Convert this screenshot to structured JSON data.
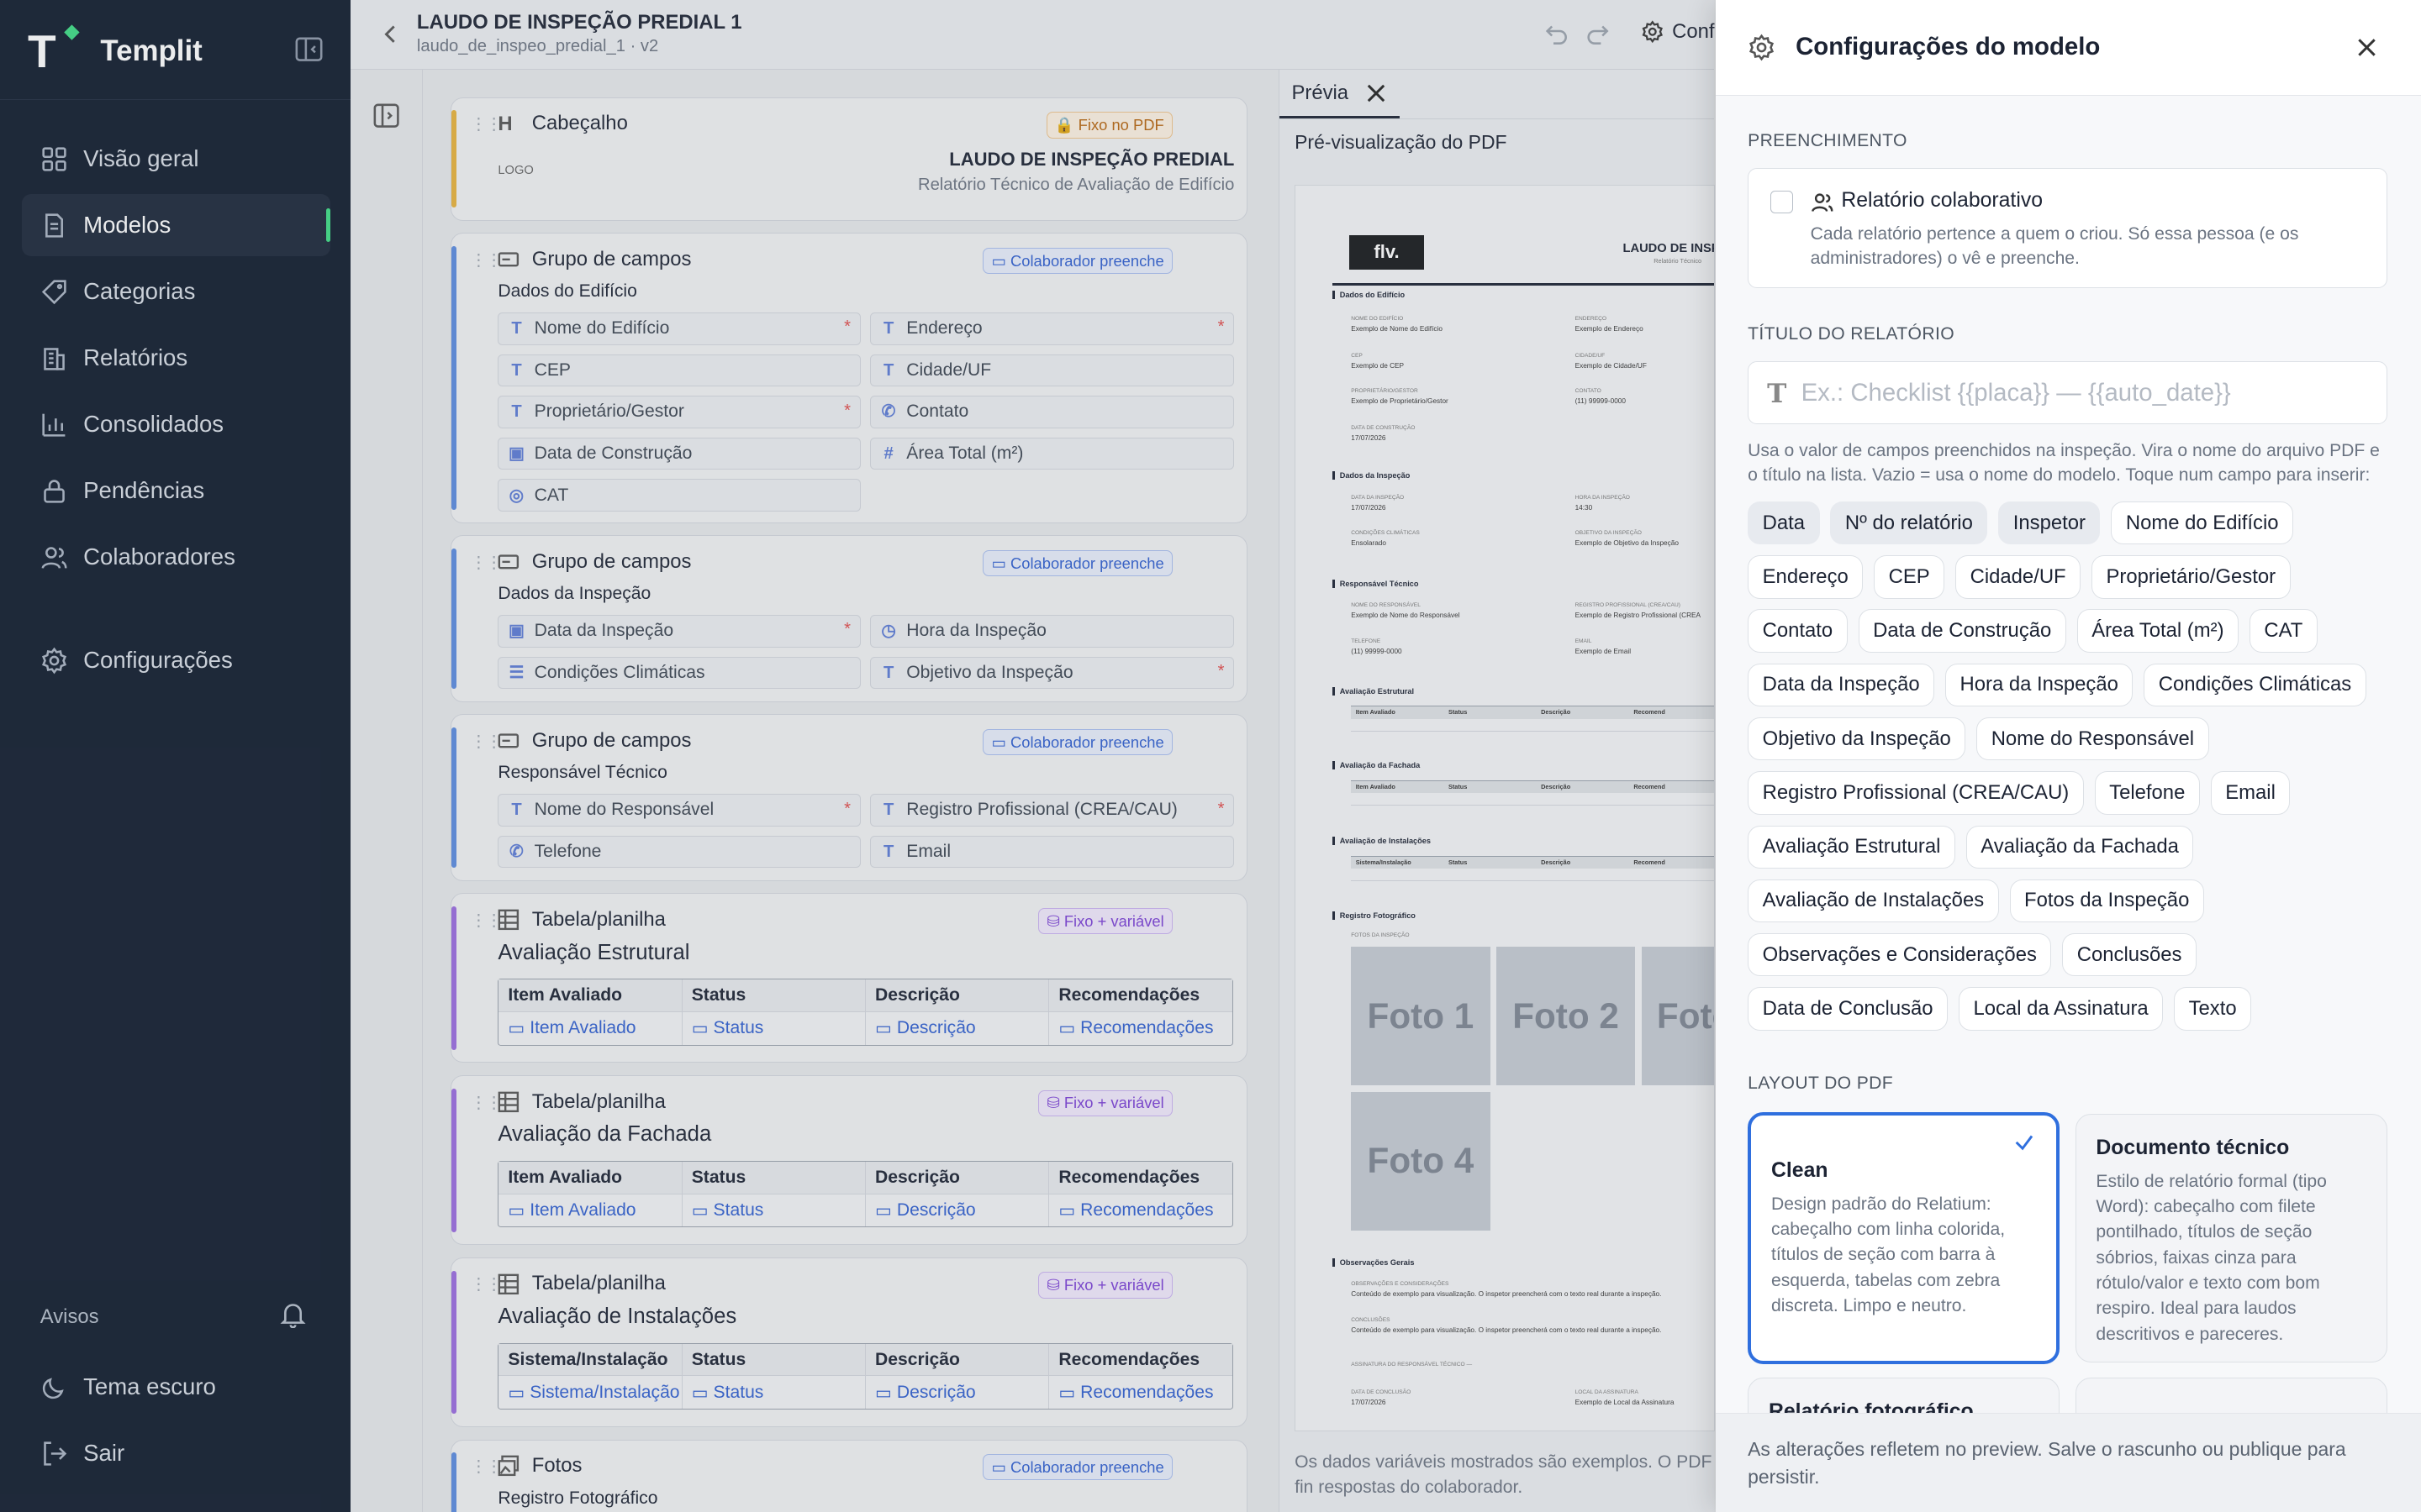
{
  "sidebar": {
    "brand": "Templit",
    "nav": [
      {
        "label": "Visão geral",
        "icon": "grid-icon"
      },
      {
        "label": "Modelos",
        "icon": "document-icon"
      },
      {
        "label": "Categorias",
        "icon": "tag-icon"
      },
      {
        "label": "Relatórios",
        "icon": "building-icon"
      },
      {
        "label": "Consolidados",
        "icon": "bar-chart-icon"
      },
      {
        "label": "Pendências",
        "icon": "lock-icon"
      },
      {
        "label": "Colaboradores",
        "icon": "users-icon"
      },
      {
        "label": "Configurações",
        "icon": "gear-icon"
      }
    ],
    "active_item": "Modelos",
    "avisos_label": "Avisos",
    "tema_label": "Tema escuro",
    "sair_label": "Sair"
  },
  "editor": {
    "title": "LAUDO DE INSPEÇÃO PREDIAL 1",
    "subtitle": "laudo_de_inspeo_predial_1 · v2",
    "config_button": "Conf",
    "header_block": {
      "label": "Cabeçalho",
      "badge": "Fixo no PDF",
      "logo": "LOGO",
      "title": "LAUDO DE INSPEÇÃO PREDIAL",
      "subtitle": "Relatório Técnico de Avaliação de Edifício"
    },
    "groups": [
      {
        "label": "Grupo de campos",
        "badge": "Colaborador preenche",
        "name": "Dados do Edifício",
        "fields": [
          "Nome do Edifício",
          "Endereço",
          "CEP",
          "Cidade/UF",
          "Proprietário/Gestor",
          "Contato",
          "Data de Construção",
          "Área Total (m²)",
          "CAT"
        ]
      },
      {
        "label": "Grupo de campos",
        "badge": "Colaborador preenche",
        "name": "Dados da Inspeção",
        "fields": [
          "Data da Inspeção",
          "Hora da Inspeção",
          "Condições Climáticas",
          "Objetivo da Inspeção"
        ]
      },
      {
        "label": "Grupo de campos",
        "badge": "Colaborador preenche",
        "name": "Responsável Técnico",
        "fields": [
          "Nome do Responsável",
          "Registro Profissional (CREA/CAU)",
          "Telefone",
          "Email"
        ]
      }
    ],
    "tables": [
      {
        "label": "Tabela/planilha",
        "badge": "Fixo + variável",
        "name": "Avaliação Estrutural",
        "columns": [
          "Item Avaliado",
          "Status",
          "Descrição",
          "Recomendações"
        ]
      },
      {
        "label": "Tabela/planilha",
        "badge": "Fixo + variável",
        "name": "Avaliação da Fachada",
        "columns": [
          "Item Avaliado",
          "Status",
          "Descrição",
          "Recomendações"
        ]
      },
      {
        "label": "Tabela/planilha",
        "badge": "Fixo + variável",
        "name": "Avaliação de Instalações",
        "columns": [
          "Sistema/Instalação",
          "Status",
          "Descrição",
          "Recomendações"
        ]
      }
    ],
    "photos_block": {
      "label": "Fotos",
      "badge": "Colaborador preenche",
      "name": "Registro Fotográfico"
    }
  },
  "preview": {
    "tab": "Prévia",
    "label": "Pré-visualização do PDF",
    "logo": "flv.",
    "doc_title": "LAUDO DE INSPEÇ",
    "doc_subtitle": "Relatório Técnico",
    "sections": [
      "Dados do Edifício",
      "Dados da Inspeção",
      "Responsável Técnico",
      "Avaliação Estrutural",
      "Avaliação da Fachada",
      "Avaliação de Instalações",
      "Registro Fotográfico",
      "Observações Gerais"
    ],
    "photos": [
      "Foto 1",
      "Foto 2",
      "Foto",
      "Foto 4"
    ],
    "footer": "Os dados variáveis mostrados são exemplos. O PDF fin respostas do colaborador."
  },
  "panel": {
    "title": "Configurações do modelo",
    "preenchimento_label": "PREENCHIMENTO",
    "collab_title": "Relatório colaborativo",
    "collab_desc": "Cada relatório pertence a quem o criou. Só essa pessoa (e os administradores) o vê e preenche.",
    "titulo_label": "TÍTULO DO RELATÓRIO",
    "titulo_placeholder": "Ex.: Checklist {{placa}} — {{auto_date}}",
    "help": "Usa o valor de campos preenchidos na inspeção. Vira o nome do arquivo PDF e o título na lista. Vazio = usa o nome do modelo. Toque num campo para inserir:",
    "chips": [
      {
        "label": "Data",
        "on": true
      },
      {
        "label": "Nº do relatório",
        "on": true
      },
      {
        "label": "Inspetor",
        "on": true
      },
      {
        "label": "Nome do Edifício"
      },
      {
        "label": "Endereço"
      },
      {
        "label": "CEP"
      },
      {
        "label": "Cidade/UF"
      },
      {
        "label": "Proprietário/Gestor"
      },
      {
        "label": "Contato"
      },
      {
        "label": "Data de Construção"
      },
      {
        "label": "Área Total (m²)"
      },
      {
        "label": "CAT"
      },
      {
        "label": "Data da Inspeção"
      },
      {
        "label": "Hora da Inspeção"
      },
      {
        "label": "Condições Climáticas"
      },
      {
        "label": "Objetivo da Inspeção"
      },
      {
        "label": "Nome do Responsável"
      },
      {
        "label": "Registro Profissional (CREA/CAU)"
      },
      {
        "label": "Telefone"
      },
      {
        "label": "Email"
      },
      {
        "label": "Avaliação Estrutural"
      },
      {
        "label": "Avaliação da Fachada"
      },
      {
        "label": "Avaliação de Instalações"
      },
      {
        "label": "Fotos da Inspeção"
      },
      {
        "label": "Observações e Considerações"
      },
      {
        "label": "Conclusões"
      },
      {
        "label": "Data de Conclusão"
      },
      {
        "label": "Local da Assinatura"
      },
      {
        "label": "Texto"
      }
    ],
    "layout_label": "LAYOUT DO PDF",
    "layouts": [
      {
        "title": "Clean",
        "desc": "Design padrão do Relatium: cabeçalho com linha colorida, títulos de seção com barra à esquerda, tabelas com zebra discreta. Limpo e neutro.",
        "selected": true
      },
      {
        "title": "Documento técnico",
        "desc": "Estilo de relatório formal (tipo Word): cabeçalho com filete pontilhado, títulos de seção sóbrios, faixas cinza para rótulo/valor e texto com bom respiro. Ideal para laudos descritivos e pareceres."
      },
      {
        "title": "Relatório fotográfico",
        "desc": ""
      }
    ],
    "footer": "As alterações refletem no preview. Salve o rascunho ou publique para persistir."
  }
}
